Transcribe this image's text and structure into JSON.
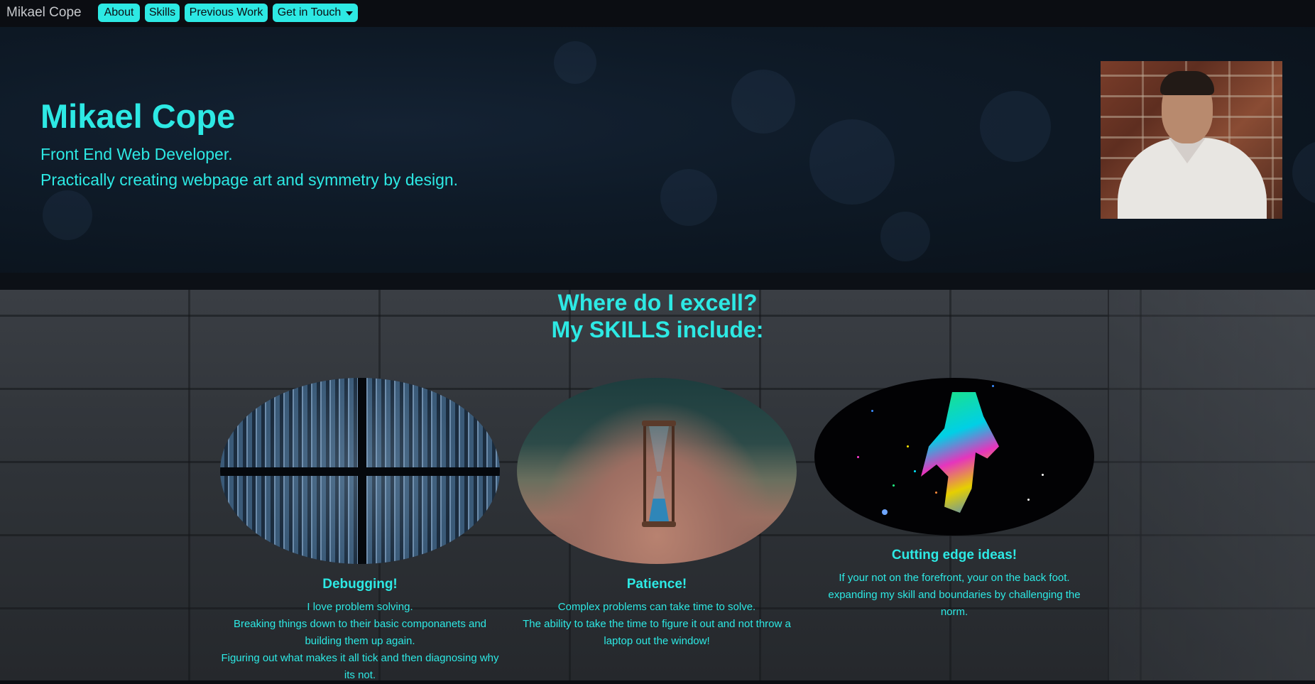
{
  "nav": {
    "brand": "Mikael Cope",
    "items": [
      {
        "label": "About"
      },
      {
        "label": "Skills"
      },
      {
        "label": "Previous Work"
      },
      {
        "label": "Get in Touch"
      }
    ]
  },
  "hero": {
    "title": "Mikael Cope",
    "subtitle_1": "Front End Web Developer.",
    "subtitle_2": "Practically creating webpage art and symmetry by design."
  },
  "skills": {
    "heading_1": "Where do I excell?",
    "heading_2": "My SKILLS include:",
    "cards": [
      {
        "title": "Debugging!",
        "lines": [
          "I love problem solving.",
          "Breaking things down to their basic componanets and building them up again.",
          "Figuring out what makes it all tick and then diagnosing why its not."
        ]
      },
      {
        "title": "Patience!",
        "lines": [
          "Complex problems can take time to solve.",
          "The ability to take the time to figure it out and not throw a laptop out the window!"
        ]
      },
      {
        "title": "Cutting edge ideas!",
        "lines": [
          "If your not on the forefront, your on the back foot. expanding my skill and boundaries by challenging the norm."
        ]
      }
    ]
  },
  "colors": {
    "accent": "#2de9e4",
    "nav_bg": "#0b0d12"
  },
  "icons": {
    "dropdown": "caret-down-icon"
  }
}
